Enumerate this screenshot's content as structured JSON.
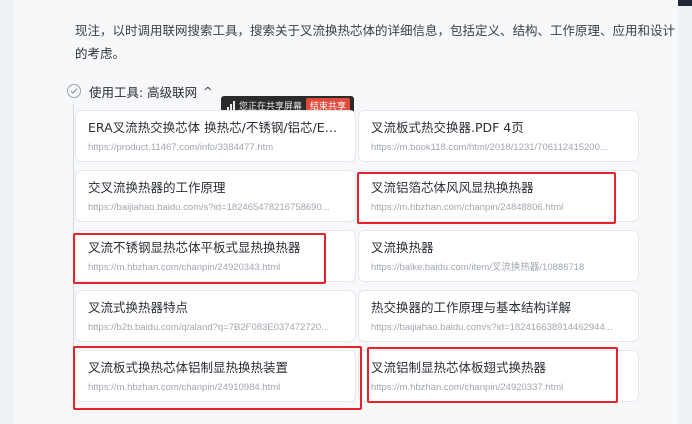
{
  "paragraph": {
    "cut_line": "现注，以时调用联网搜索工具，搜索关于叉流换热芯体的详细信息，包括定义、结构、工作原理、应用和设计",
    "end_line": "的考虑。"
  },
  "tool": {
    "label": "使用工具: 高级联网",
    "chevron": "^"
  },
  "share_banner": {
    "text": "您正在共享屏幕",
    "stop_label": "结束共享"
  },
  "results": [
    {
      "title": "ERA叉流热交换芯体 换热芯/不锈钢/铝芯/ERA叉...",
      "url": "https://product.11467.com/info/3384477.htm"
    },
    {
      "title": "叉流板式热交换器.PDF 4页",
      "url": "https://m.book118.com/html/2018/1231/706112415200..."
    },
    {
      "title": "交叉流换热器的工作原理",
      "url": "https://baijiahao.baidu.com/s?id=182465478216758690..."
    },
    {
      "title": "叉流铝箔芯体风风显热换热器",
      "url": "https://m.hbzhan.com/chanpin/24848806.html"
    },
    {
      "title": "叉流不锈钢显热芯体平板式显热换热器",
      "url": "https://m.hbzhan.com/chanpin/24920343.html"
    },
    {
      "title": "叉流换热器",
      "url": "https://baike.baidu.com/item/叉流换热器/10886718"
    },
    {
      "title": "叉流式换热器特点",
      "url": "https://b2b.baidu.com/q/aland?q=7B2F083E037472720..."
    },
    {
      "title": "热交换器的工作原理与基本结构详解",
      "url": "https://baijiahao.baidu.com/s?id=182416638914462944..."
    },
    {
      "title": "叉流板式换热芯体铝制显热换热装置",
      "url": "https://m.hbzhan.com/chanpin/24910984.html"
    },
    {
      "title": "叉流铝制显热芯体板翅式换热器",
      "url": "https://m.hbzhan.com/chanpin/24920337.html"
    }
  ],
  "colors": {
    "highlight": "#e8222a",
    "page_bg": "#eef1f6",
    "card_bg": "#ffffff",
    "share_stop": "#e14b3b"
  }
}
